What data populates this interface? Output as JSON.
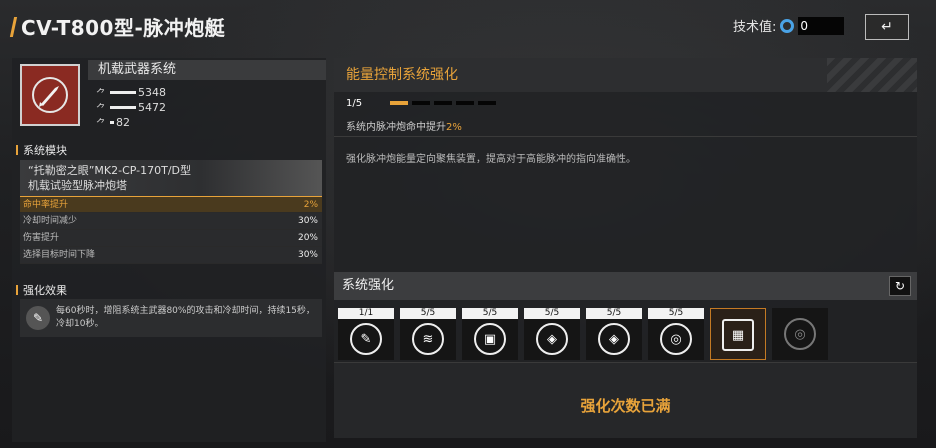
{
  "header": {
    "title": "CV-T800型-脉冲炮艇",
    "tech_label": "技术值:",
    "tech_value": "0",
    "back_icon": "return-icon"
  },
  "weapon": {
    "name": "机载武器系统",
    "icon": "missile-icon",
    "stats": [
      "5348",
      "5472",
      "82"
    ]
  },
  "modules": {
    "heading": "系统模块",
    "module_name": "“托勒密之眼”MK2-CP-170T/D型",
    "module_desc": "机载试验型脉冲炮塔",
    "rows": [
      {
        "label": "命中率提升",
        "value": "2%"
      },
      {
        "label": "冷却时间减少",
        "value": "30%"
      },
      {
        "label": "伤害提升",
        "value": "20%"
      },
      {
        "label": "选择目标时间下降",
        "value": "30%"
      }
    ]
  },
  "effect": {
    "heading": "强化效果",
    "text": "每60秒时，增阻系统主武器80%的攻击和冷却时间，持续15秒，冷却10秒。"
  },
  "detail": {
    "title": "能量控制系统强化",
    "level": "1/5",
    "level_current": 1,
    "level_max": 5,
    "sub_text": "系统内脉冲炮命中提升",
    "sub_value": "2%",
    "description": "强化脉冲炮能量定向聚焦装置，提高对于高能脉冲的指向准确性。"
  },
  "system": {
    "heading": "系统强化",
    "refresh_icon": "refresh-icon",
    "slots": [
      {
        "count": "1/1",
        "icon": "wrench-icon",
        "glyph": "✎"
      },
      {
        "count": "5/5",
        "icon": "heat-icon",
        "glyph": "≋"
      },
      {
        "count": "5/5",
        "icon": "battery-icon",
        "glyph": "▣"
      },
      {
        "count": "5/5",
        "icon": "shield-burst-icon",
        "glyph": "◈"
      },
      {
        "count": "5/5",
        "icon": "shield-burst-icon",
        "glyph": "◈"
      },
      {
        "count": "5/5",
        "icon": "orbit-icon",
        "glyph": "◎"
      }
    ],
    "selected_icon": "chip-icon",
    "locked_icon": "orbit-icon",
    "maxed_text": "强化次数已满"
  },
  "colors": {
    "accent": "#e8a33a",
    "weapon_bg": "#8a2a22"
  }
}
